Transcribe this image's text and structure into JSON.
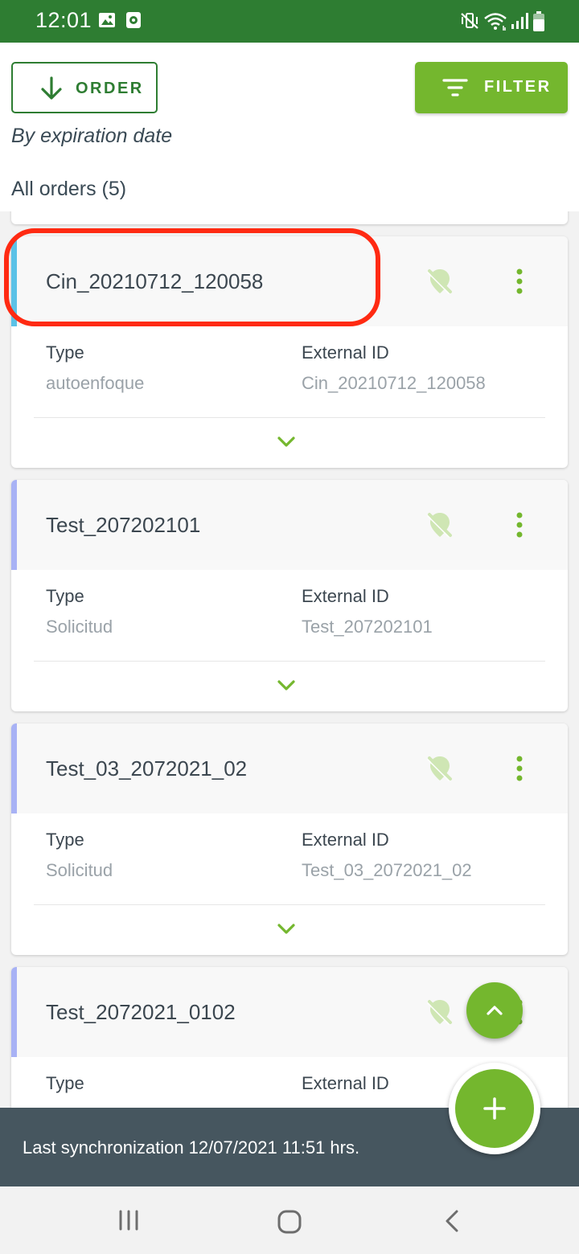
{
  "status_bar": {
    "time": "12:01",
    "left_icons": [
      "image-icon",
      "media-icon"
    ],
    "right_icons": [
      "mute-vibrate-icon",
      "wifi-icon",
      "signal-icon",
      "battery-icon"
    ]
  },
  "header": {
    "order_label": "ORDER",
    "filter_label": "FILTER",
    "sort_description": "By expiration date",
    "count_label": "All orders (5)"
  },
  "cards": [
    {
      "title": "Cin_20210712_120058",
      "type_label": "Type",
      "type_value": "autoenfoque",
      "ext_label": "External ID",
      "ext_value": "Cin_20210712_120058",
      "accent": "#5bc2e7"
    },
    {
      "title": "Test_207202101",
      "type_label": "Type",
      "type_value": "Solicitud",
      "ext_label": "External ID",
      "ext_value": "Test_207202101",
      "accent": "#a8b2f5"
    },
    {
      "title": "Test_03_2072021_02",
      "type_label": "Type",
      "type_value": "Solicitud",
      "ext_label": "External ID",
      "ext_value": "Test_03_2072021_02",
      "accent": "#a8b2f5"
    },
    {
      "title": "Test_2072021_0102",
      "type_label": "Type",
      "type_value": "",
      "ext_label": "External ID",
      "ext_value": "",
      "accent": "#a8b2f5"
    }
  ],
  "sync": {
    "text": "Last synchronization 12/07/2021 11:51 hrs."
  },
  "colors": {
    "status_bar": "#2e7d32",
    "primary_green": "#74b72e",
    "sync_bar": "#46565f",
    "highlight": "#ff2a12"
  }
}
